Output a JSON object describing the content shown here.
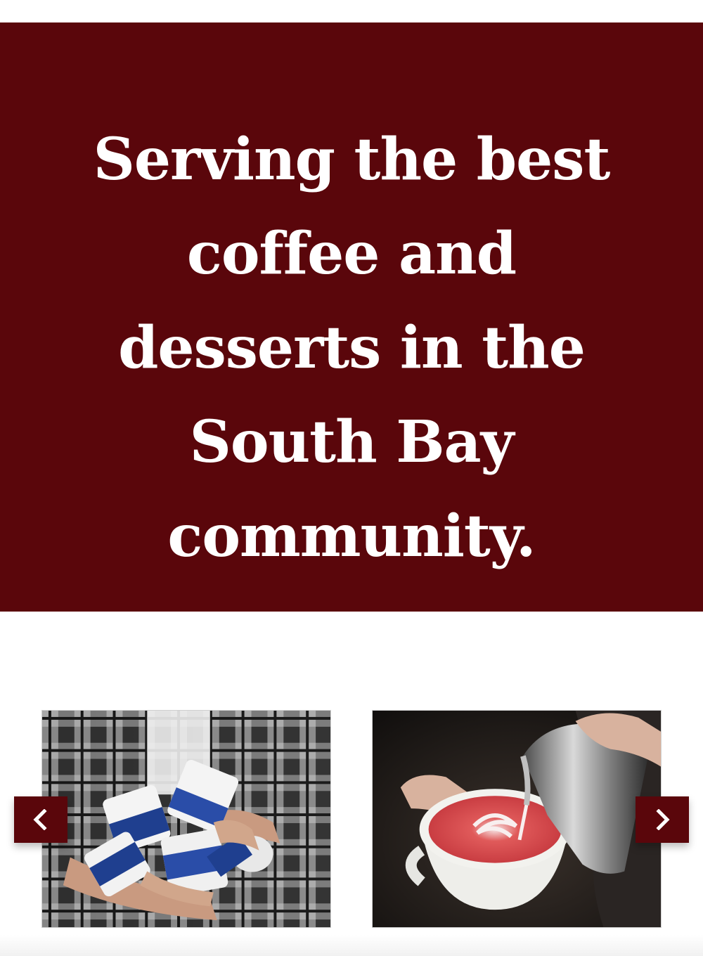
{
  "hero": {
    "title": "Serving the best coffee and desserts in the South Bay community.",
    "background_color": "#5a060b",
    "text_color": "#ffffff"
  },
  "carousel": {
    "slides": [
      {
        "icon": "ice-cream-pints-photo"
      },
      {
        "icon": "latte-art-photo"
      }
    ],
    "prev_icon": "chevron-left-icon",
    "next_icon": "chevron-right-icon",
    "button_color": "#5a060b"
  }
}
